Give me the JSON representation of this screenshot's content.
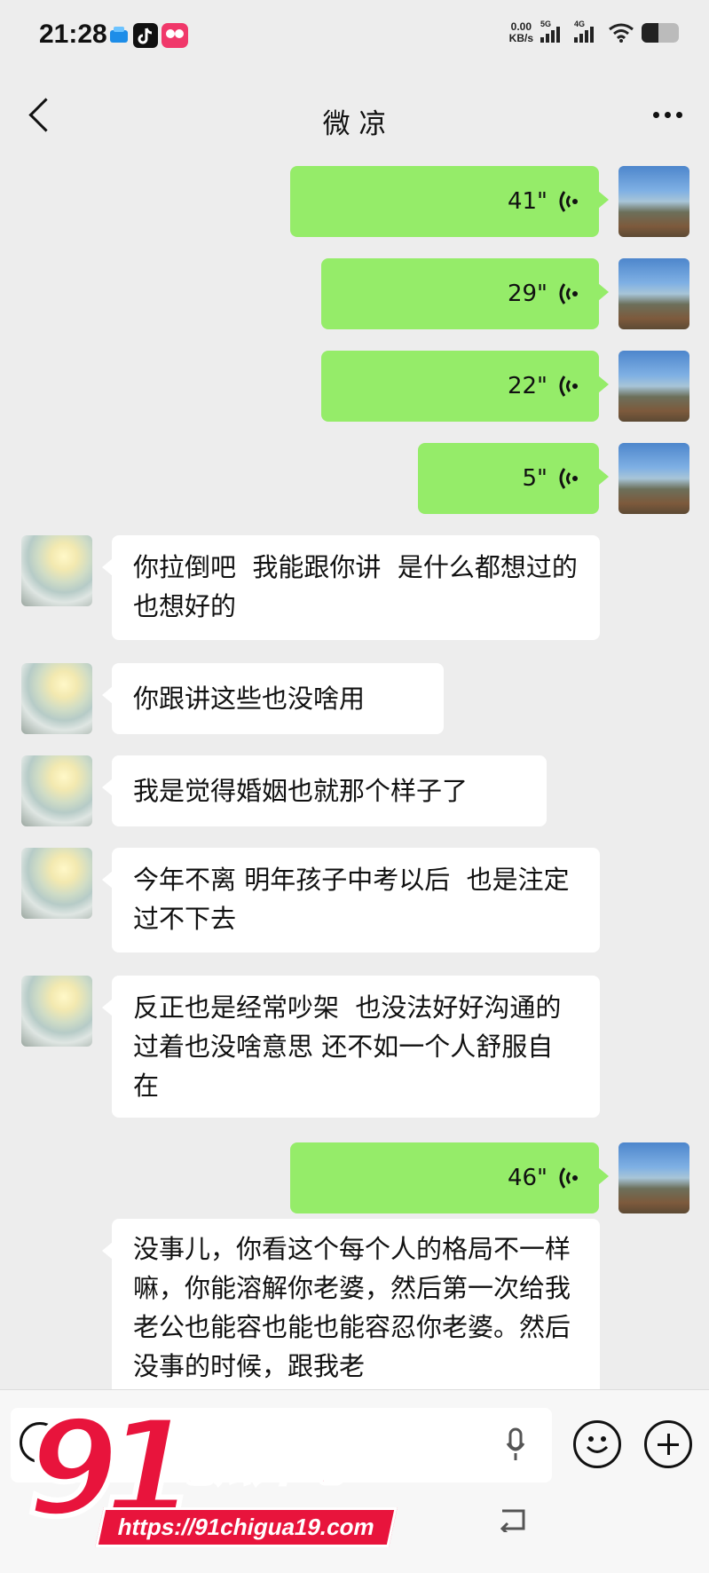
{
  "status_bar": {
    "time": "21:28",
    "net_speed_value": "0.00",
    "net_speed_unit": "KB/s",
    "signal_1_label": "5G",
    "signal_2_label": "4G",
    "battery_level": 0.45,
    "app_icons": [
      "cloud-app-icon",
      "tiktok-icon",
      "game-app-icon"
    ]
  },
  "header": {
    "title": "微 凉",
    "back_icon": "chevron-left-icon",
    "more_icon": "more-dots-icon"
  },
  "messages": [
    {
      "side": "mine",
      "type": "voice",
      "duration": "41\""
    },
    {
      "side": "mine",
      "type": "voice",
      "duration": "29\""
    },
    {
      "side": "mine",
      "type": "voice",
      "duration": "22\""
    },
    {
      "side": "mine",
      "type": "voice",
      "duration": "5\""
    },
    {
      "side": "theirs",
      "type": "text",
      "text": "你拉倒吧  我能跟你讲  是什么都想过的  也想好的"
    },
    {
      "side": "theirs",
      "type": "text",
      "text": "你跟讲这些也没啥用"
    },
    {
      "side": "theirs",
      "type": "text",
      "text": "我是觉得婚姻也就那个样子了"
    },
    {
      "side": "theirs",
      "type": "text",
      "text": "今年不离 明年孩子中考以后  也是注定过不下去"
    },
    {
      "side": "theirs",
      "type": "text",
      "text": "反正也是经常吵架  也没法好好沟通的 过着也没啥意思 还不如一个人舒服自在"
    },
    {
      "side": "mine",
      "type": "voice",
      "duration": "46\""
    },
    {
      "side": "theirs",
      "type": "text",
      "text": "没事儿，你看这个每个人的格局不一样嘛，你能溶解你老婆，然后第一次给我老公也能容也能也能容忍你老婆。然后没事的时候，跟我老"
    }
  ],
  "input_bar": {
    "voice_toggle_icon": "voice-toggle-icon",
    "mic_icon": "mic-icon",
    "emoji_icon": "emoji-icon",
    "plus_icon": "plus-icon",
    "nav_back_icon": "nav-back-icon"
  },
  "watermark": {
    "number": "91",
    "text": "吃瓜中心",
    "url": "https://91chigua19.com"
  },
  "colors": {
    "bubble_mine": "#95ec69",
    "bubble_theirs": "#ffffff",
    "background": "#ededed",
    "watermark_red": "#e8143c"
  }
}
